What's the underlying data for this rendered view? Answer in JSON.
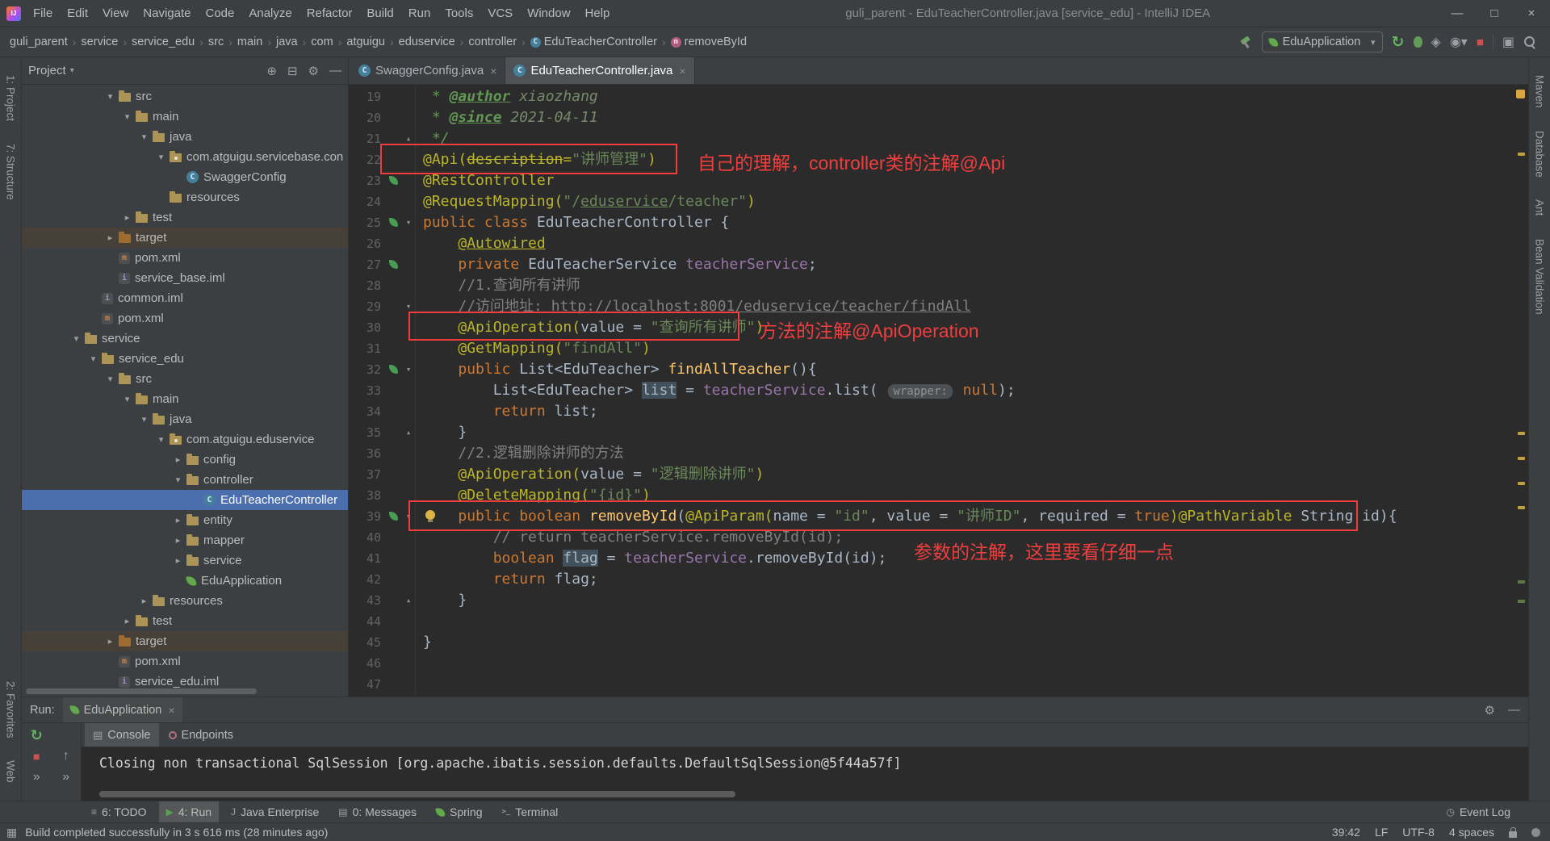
{
  "colors": {
    "accent_red": "#f03e3e",
    "selection_blue": "#4b6eaf",
    "editor_bg": "#2b2b2b",
    "panel_bg": "#3c3f41"
  },
  "title_bar": {
    "title": "guli_parent - EduTeacherController.java [service_edu] - IntelliJ IDEA",
    "menus": [
      "File",
      "Edit",
      "View",
      "Navigate",
      "Code",
      "Analyze",
      "Refactor",
      "Build",
      "Run",
      "Tools",
      "VCS",
      "Window",
      "Help"
    ]
  },
  "nav_bar": {
    "breadcrumbs": [
      "guli_parent",
      "service",
      "service_edu",
      "src",
      "main",
      "java",
      "com",
      "atguigu",
      "eduservice",
      "controller",
      "EduTeacherController",
      "removeById"
    ],
    "run_config": "EduApplication"
  },
  "left_stripe": {
    "top": [
      "1: Project",
      "7: Structure"
    ],
    "bottom": [
      "2: Favorites",
      "Web"
    ]
  },
  "right_stripe": {
    "top": [
      "Maven",
      "Database",
      "Ant",
      "Bean Validation"
    ]
  },
  "project_panel": {
    "title": "Project",
    "tree": [
      {
        "label": "src",
        "lvl": 3,
        "arrow": "open",
        "icon": "folder"
      },
      {
        "label": "main",
        "lvl": 4,
        "arrow": "open",
        "icon": "folder"
      },
      {
        "label": "java",
        "lvl": 5,
        "arrow": "open",
        "icon": "folder"
      },
      {
        "label": "com.atguigu.servicebase.con",
        "lvl": 6,
        "arrow": "open",
        "icon": "package"
      },
      {
        "label": "SwaggerConfig",
        "lvl": 7,
        "icon": "class"
      },
      {
        "label": "resources",
        "lvl": 6,
        "icon": "folder"
      },
      {
        "label": "test",
        "lvl": 4,
        "arrow": "closed",
        "icon": "folder"
      },
      {
        "label": "target",
        "lvl": 3,
        "arrow": "closed",
        "icon": "folder-ex",
        "excluded": true
      },
      {
        "label": "pom.xml",
        "lvl": 3,
        "icon": "maven"
      },
      {
        "label": "service_base.iml",
        "lvl": 3,
        "icon": "iml"
      },
      {
        "label": "common.iml",
        "lvl": 2,
        "icon": "iml"
      },
      {
        "label": "pom.xml",
        "lvl": 2,
        "icon": "maven"
      },
      {
        "label": "service",
        "lvl": 1,
        "arrow": "open",
        "icon": "folder"
      },
      {
        "label": "service_edu",
        "lvl": 2,
        "arrow": "open",
        "icon": "folder"
      },
      {
        "label": "src",
        "lvl": 3,
        "arrow": "open",
        "icon": "folder"
      },
      {
        "label": "main",
        "lvl": 4,
        "arrow": "open",
        "icon": "folder"
      },
      {
        "label": "java",
        "lvl": 5,
        "arrow": "open",
        "icon": "folder"
      },
      {
        "label": "com.atguigu.eduservice",
        "lvl": 6,
        "arrow": "open",
        "icon": "package"
      },
      {
        "label": "config",
        "lvl": 7,
        "arrow": "closed",
        "icon": "folder"
      },
      {
        "label": "controller",
        "lvl": 7,
        "arrow": "open",
        "icon": "folder"
      },
      {
        "label": "EduTeacherController",
        "lvl": 8,
        "icon": "class",
        "selected": true
      },
      {
        "label": "entity",
        "lvl": 7,
        "arrow": "closed",
        "icon": "folder"
      },
      {
        "label": "mapper",
        "lvl": 7,
        "arrow": "closed",
        "icon": "folder"
      },
      {
        "label": "service",
        "lvl": 7,
        "arrow": "closed",
        "icon": "folder"
      },
      {
        "label": "EduApplication",
        "lvl": 7,
        "icon": "spring"
      },
      {
        "label": "resources",
        "lvl": 5,
        "arrow": "closed",
        "icon": "folder"
      },
      {
        "label": "test",
        "lvl": 4,
        "arrow": "closed",
        "icon": "folder"
      },
      {
        "label": "target",
        "lvl": 3,
        "arrow": "closed",
        "icon": "folder-ex",
        "excluded": true
      },
      {
        "label": "pom.xml",
        "lvl": 3,
        "icon": "maven"
      },
      {
        "label": "service_edu.iml",
        "lvl": 3,
        "icon": "iml"
      }
    ]
  },
  "editor": {
    "tabs": [
      {
        "label": "SwaggerConfig.java",
        "active": false
      },
      {
        "label": "EduTeacherController.java",
        "active": true
      }
    ],
    "lines": [
      {
        "n": 19,
        "s": [
          [
            " * ",
            "doc"
          ],
          [
            "@author",
            "doctag"
          ],
          [
            " xiaozhang",
            "docv"
          ]
        ]
      },
      {
        "n": 20,
        "s": [
          [
            " * ",
            "doc"
          ],
          [
            "@since",
            "doctag"
          ],
          [
            " 2021-04-11",
            "docv"
          ]
        ]
      },
      {
        "n": 21,
        "f": "up",
        "s": [
          [
            " */",
            "doc"
          ]
        ]
      },
      {
        "n": 22,
        "s": [
          [
            "@Api(",
            "ann"
          ],
          [
            "description",
            "annstrike"
          ],
          [
            "=",
            "ann"
          ],
          [
            "\"讲师管理\"",
            "str"
          ],
          [
            ")",
            "ann"
          ]
        ]
      },
      {
        "n": 23,
        "g": 1,
        "s": [
          [
            "@RestController",
            "ann"
          ]
        ]
      },
      {
        "n": 24,
        "s": [
          [
            "@RequestMapping(",
            "ann"
          ],
          [
            "\"/",
            "str"
          ],
          [
            "eduservice",
            "stru"
          ],
          [
            "/teacher\"",
            "str"
          ],
          [
            ")",
            "ann"
          ]
        ]
      },
      {
        "n": 25,
        "g": 1,
        "f": "down",
        "s": [
          [
            "public class ",
            "kw"
          ],
          [
            "EduTeacherController {",
            "d"
          ]
        ]
      },
      {
        "n": 26,
        "s": [
          [
            "    ",
            "d"
          ],
          [
            "@Autowired",
            "annu"
          ]
        ]
      },
      {
        "n": 27,
        "g": 1,
        "s": [
          [
            "    ",
            "d"
          ],
          [
            "private ",
            "kw"
          ],
          [
            "EduTeacherService ",
            "d"
          ],
          [
            "teacherService",
            "fld"
          ],
          [
            ";",
            "d"
          ]
        ]
      },
      {
        "n": 28,
        "s": [
          [
            "    ",
            "d"
          ],
          [
            "//1.查询所有讲师",
            "cmt"
          ]
        ]
      },
      {
        "n": 29,
        "f": "down",
        "s": [
          [
            "    ",
            "d"
          ],
          [
            "//访问地址: ",
            "cmt"
          ],
          [
            "http://localhost:8001/eduservice/teacher/findAll",
            "cmtu"
          ]
        ]
      },
      {
        "n": 30,
        "s": [
          [
            "    ",
            "d"
          ],
          [
            "@ApiOperation(",
            "ann"
          ],
          [
            "value = ",
            "d"
          ],
          [
            "\"查询所有讲师\"",
            "str"
          ],
          [
            ")",
            "ann"
          ]
        ]
      },
      {
        "n": 31,
        "s": [
          [
            "    ",
            "d"
          ],
          [
            "@GetMapping(",
            "ann"
          ],
          [
            "\"findAll\"",
            "str"
          ],
          [
            ")",
            "ann"
          ]
        ]
      },
      {
        "n": 32,
        "g": 1,
        "f": "down",
        "s": [
          [
            "    ",
            "d"
          ],
          [
            "public ",
            "kw"
          ],
          [
            "List<EduTeacher> ",
            "d"
          ],
          [
            "findAllTeacher",
            "mth"
          ],
          [
            "(){",
            "d"
          ]
        ]
      },
      {
        "n": 33,
        "s": [
          [
            "        List<EduTeacher> ",
            "d"
          ],
          [
            "list",
            "hl"
          ],
          [
            " = ",
            "d"
          ],
          [
            "teacherService",
            "fld"
          ],
          [
            ".list( ",
            "d"
          ],
          [
            "wrapper:",
            "hint"
          ],
          [
            " ",
            "d"
          ],
          [
            "null",
            "kw"
          ],
          [
            ");",
            "d"
          ]
        ]
      },
      {
        "n": 34,
        "s": [
          [
            "        ",
            "d"
          ],
          [
            "return ",
            "kw"
          ],
          [
            "list;",
            "d"
          ]
        ]
      },
      {
        "n": 35,
        "f": "up",
        "s": [
          [
            "    }",
            "d"
          ]
        ]
      },
      {
        "n": 36,
        "s": [
          [
            "    ",
            "d"
          ],
          [
            "//2.逻辑删除讲师的方法",
            "cmt"
          ]
        ]
      },
      {
        "n": 37,
        "s": [
          [
            "    ",
            "d"
          ],
          [
            "@ApiOperation(",
            "ann"
          ],
          [
            "value = ",
            "d"
          ],
          [
            "\"逻辑删除讲师\"",
            "str"
          ],
          [
            ")",
            "ann"
          ]
        ]
      },
      {
        "n": 38,
        "s": [
          [
            "    ",
            "d"
          ],
          [
            "@DeleteMapping(",
            "ann"
          ],
          [
            "\"{id}\"",
            "str"
          ],
          [
            ")",
            "ann"
          ]
        ]
      },
      {
        "n": 39,
        "g": 1,
        "b": 1,
        "f": "down",
        "s": [
          [
            "    ",
            "d"
          ],
          [
            "public boolean ",
            "kw"
          ],
          [
            "removeById",
            "mth"
          ],
          [
            "(",
            "d"
          ],
          [
            "@ApiParam(",
            "ann"
          ],
          [
            "name = ",
            "d"
          ],
          [
            "\"id\"",
            "str"
          ],
          [
            ", ",
            "d"
          ],
          [
            "value = ",
            "d"
          ],
          [
            "\"讲师ID\"",
            "str"
          ],
          [
            ", ",
            "d"
          ],
          [
            "required = ",
            "d"
          ],
          [
            "true",
            "kw"
          ],
          [
            ")",
            "ann"
          ],
          [
            "@PathVariable",
            "ann"
          ],
          [
            " String id){",
            "d"
          ]
        ]
      },
      {
        "n": 40,
        "s": [
          [
            "        ",
            "d"
          ],
          [
            "// return teacherService.removeById(id);",
            "cmt"
          ]
        ]
      },
      {
        "n": 41,
        "s": [
          [
            "        ",
            "d"
          ],
          [
            "boolean ",
            "kw"
          ],
          [
            "flag",
            "hl"
          ],
          [
            " = ",
            "d"
          ],
          [
            "teacherService",
            "fld"
          ],
          [
            ".removeById(id);",
            "d"
          ]
        ]
      },
      {
        "n": 42,
        "s": [
          [
            "        ",
            "d"
          ],
          [
            "return ",
            "kw"
          ],
          [
            "flag;",
            "d"
          ]
        ]
      },
      {
        "n": 43,
        "f": "up",
        "s": [
          [
            "    }",
            "d"
          ]
        ]
      },
      {
        "n": 44,
        "s": []
      },
      {
        "n": 45,
        "s": [
          [
            "}",
            "d"
          ]
        ]
      },
      {
        "n": 46,
        "s": []
      },
      {
        "n": 47,
        "s": []
      }
    ]
  },
  "overlay_notes": [
    {
      "text": "自己的理解，controller类的注解@Api"
    },
    {
      "text": "方法的注解@ApiOperation"
    },
    {
      "text": "参数的注解，这里要看仔细一点"
    }
  ],
  "run_panel": {
    "label": "Run:",
    "tab": "EduApplication",
    "views": [
      {
        "label": "Console",
        "icon": "console",
        "active": true
      },
      {
        "label": "Endpoints",
        "icon": "endpoints",
        "active": false
      }
    ],
    "console_line": "Closing non transactional SqlSession [org.apache.ibatis.session.defaults.DefaultSqlSession@5f44a57f]"
  },
  "bottom_bar": {
    "left": [
      {
        "label": "6: TODO",
        "icon": "todo"
      },
      {
        "label": "4: Run",
        "icon": "run",
        "active": true
      },
      {
        "label": "Java Enterprise",
        "icon": "javaee"
      },
      {
        "label": "0: Messages",
        "icon": "messages"
      },
      {
        "label": "Spring",
        "icon": "spring"
      },
      {
        "label": "Terminal",
        "icon": "terminal"
      }
    ],
    "right": [
      {
        "label": "Event Log",
        "icon": "eventlog"
      }
    ]
  },
  "status_bar": {
    "message": "Build completed successfully in 3 s 616 ms (28 minutes ago)",
    "caret": "39:42",
    "line_sep": "LF",
    "encoding": "UTF-8",
    "indent": "4 spaces"
  }
}
